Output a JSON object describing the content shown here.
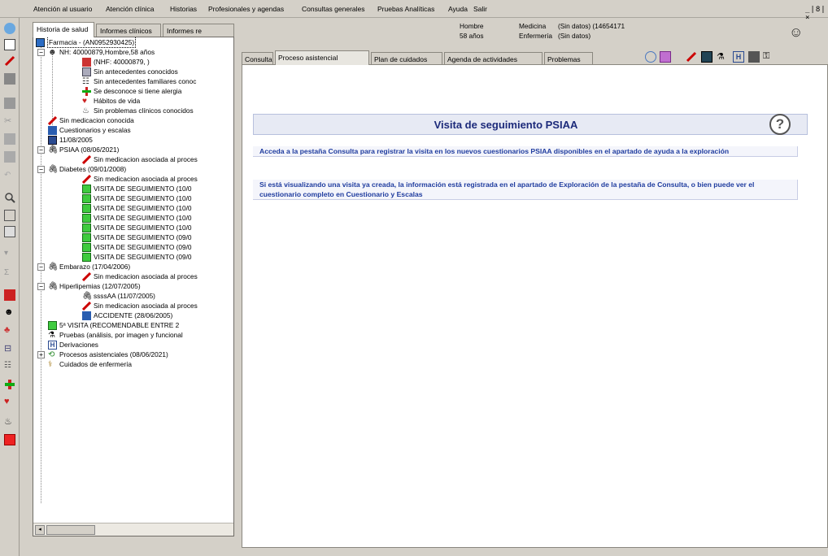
{
  "menu": [
    "Atención al usuario",
    "Atención clínica",
    "Historias",
    "Profesionales y agendas",
    "Consultas generales",
    "Pruebas Analíticas",
    "Ayuda",
    "Salir"
  ],
  "window_controls": "_|8|×",
  "left_tabs": [
    "Historia de salud",
    "Informes clínicos",
    "Informes re"
  ],
  "tree": {
    "root": "Farmacia - (AN0952930425)",
    "patient": "NH: 40000879,Hombre,58 años",
    "nhf": "(NHF: 40000879, )",
    "antecedentes": "Sin antecedentes conocidos",
    "familiares": "Sin antecedentes familiares conoc",
    "alergia": "Se desconoce si tiene alergia",
    "habitos": "Hábitos de vida",
    "problemas": "Sin problemas clínicos conocidos",
    "medicacion": "Sin medicacion conocida",
    "cuestionarios": "Cuestionarios y escalas",
    "fecha": "11/08/2005",
    "psiaa": "PSIAA (08/06/2021)",
    "psiaa_med": "Sin medicacion asociada al proces",
    "diabetes": "Diabetes (09/01/2008)",
    "diabetes_med": "Sin medicacion asociada al proces",
    "visitas": [
      "VISITA DE SEGUIMIENTO (10/0",
      "VISITA DE SEGUIMIENTO (10/0",
      "VISITA DE SEGUIMIENTO (10/0",
      "VISITA DE SEGUIMIENTO (10/0",
      "VISITA DE SEGUIMIENTO (10/0",
      "VISITA DE SEGUIMIENTO (09/0",
      "VISITA DE SEGUIMIENTO (09/0",
      "VISITA DE SEGUIMIENTO (09/0"
    ],
    "embarazo": "Embarazo (17/04/2006)",
    "embarazo_med": "Sin medicacion asociada al proces",
    "hiperlipemias": "Hiperlipemias (12/07/2005)",
    "sssaa": "ssssAA (11/07/2005)",
    "hiper_med": "Sin medicacion asociada al proces",
    "accidente": "ACCIDENTE (28/06/2005)",
    "visita5": "5ª VISITA (RECOMENDABLE ENTRE 2",
    "pruebas": "Pruebas (análisis, por imagen y funcional",
    "derivaciones": "Derivaciones",
    "procesos": "Procesos asistenciales (08/06/2021)",
    "cuidados": "Cuidados de enfermería"
  },
  "patient_info": {
    "sexo": "Hombre",
    "edad": "58 años",
    "medicina": "Medicina",
    "enfermeria": "Enfermería",
    "medicina_val": "(Sin datos) (14654171",
    "enfermeria_val": "(Sin datos)"
  },
  "right_tabs": [
    "Consulta",
    "Proceso asistencial",
    "Plan de cuidados",
    "Agenda de actividades",
    "Problemas"
  ],
  "active_right_tab": "Proceso asistencial",
  "card": {
    "title": "Visita de seguimiento PSIAA",
    "help": "?",
    "msg1": "Acceda a la pestaña Consulta para registrar la visita en los nuevos cuestionarios PSIAA disponibles en el apartado de ayuda a la exploración",
    "msg2": "Si está visualizando una visita ya creada, la información está registrada en el apartado de Exploración de la pestaña de Consulta, o bien puede ver el cuestionario completo en Cuestionario y Escalas"
  },
  "colors": {
    "window_bg": "#d4d0c8",
    "title_text": "#1c2a7a",
    "message_text": "#1f3c9f",
    "visit_icon": "#3ecb3e"
  }
}
